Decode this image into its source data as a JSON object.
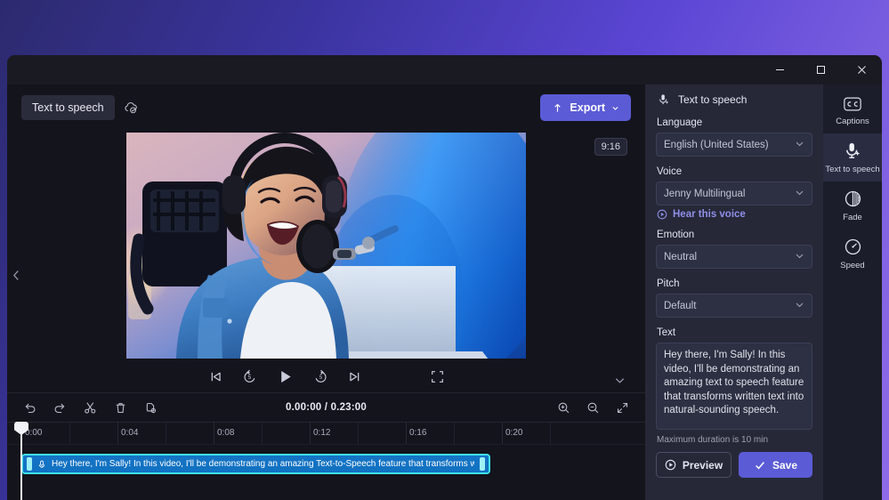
{
  "window": {
    "minimize_label": "Minimize",
    "maximize_label": "Maximize",
    "close_label": "Close"
  },
  "topbar": {
    "project_name": "Text to speech",
    "cloud_status_icon": "cloud-check-icon",
    "export_label": "Export"
  },
  "preview": {
    "aspect_ratio": "9:16",
    "collapse_icon": "chevron-left-icon",
    "controls": [
      {
        "name": "skip-previous",
        "icon": "skip-previous-icon"
      },
      {
        "name": "rewind-5",
        "icon": "rewind-5-icon"
      },
      {
        "name": "play",
        "icon": "play-icon"
      },
      {
        "name": "forward-5",
        "icon": "forward-5-icon"
      },
      {
        "name": "skip-next",
        "icon": "skip-next-icon"
      },
      {
        "name": "fullscreen",
        "icon": "fullscreen-icon"
      }
    ],
    "expand_icon": "chevron-down-icon"
  },
  "timeline": {
    "tools": [
      {
        "name": "undo",
        "icon": "undo-icon"
      },
      {
        "name": "redo",
        "icon": "redo-icon"
      },
      {
        "name": "split",
        "icon": "scissors-icon"
      },
      {
        "name": "delete",
        "icon": "trash-icon"
      },
      {
        "name": "duplicate",
        "icon": "duplicate-icon"
      }
    ],
    "current_time": "0.00:00",
    "total_time": "0.23:00",
    "time_display": "0.00:00 / 0.23:00",
    "zoom_tools": [
      {
        "name": "zoom-in",
        "icon": "zoom-in-icon"
      },
      {
        "name": "zoom-out",
        "icon": "zoom-out-icon"
      },
      {
        "name": "fit-to-screen",
        "icon": "fit-screen-icon"
      }
    ],
    "ruler_labels": [
      "0:00",
      "0:04",
      "0:08",
      "0:12",
      "0:16",
      "0:20"
    ],
    "clip": {
      "icon": "microphone-icon",
      "text": "Hey there, I'm Sally! In this video, I'll be demonstrating an amazing Text-to-Speech feature that transforms w"
    },
    "playhead_time": "0:00"
  },
  "panel": {
    "title": "Text to speech",
    "title_icon": "microphone-sparkle-icon",
    "language_label": "Language",
    "language_value": "English (United States)",
    "voice_label": "Voice",
    "voice_value": "Jenny Multilingual",
    "hear_voice_label": "Hear this voice",
    "emotion_label": "Emotion",
    "emotion_value": "Neutral",
    "pitch_label": "Pitch",
    "pitch_value": "Default",
    "text_label": "Text",
    "text_value": "Hey there, I'm Sally! In this video, I'll be demonstrating an amazing text to speech feature that transforms written text into natural-sounding speech.",
    "max_duration_note": "Maximum duration is 10 min",
    "preview_label": "Preview",
    "save_label": "Save"
  },
  "rail": {
    "items": [
      {
        "label": "Captions",
        "icon": "closed-captions-icon",
        "active": false
      },
      {
        "label": "Text to speech",
        "icon": "microphone-sparkle-icon",
        "active": true
      },
      {
        "label": "Fade",
        "icon": "fade-icon",
        "active": false
      },
      {
        "label": "Speed",
        "icon": "speedometer-icon",
        "active": false
      }
    ]
  },
  "colors": {
    "accent": "#5b5bd6",
    "clip": "#1574c4",
    "clip_border": "#3fe0e8",
    "panel_bg": "#262838",
    "window_bg": "#14141c",
    "link": "#8f8fe8"
  }
}
